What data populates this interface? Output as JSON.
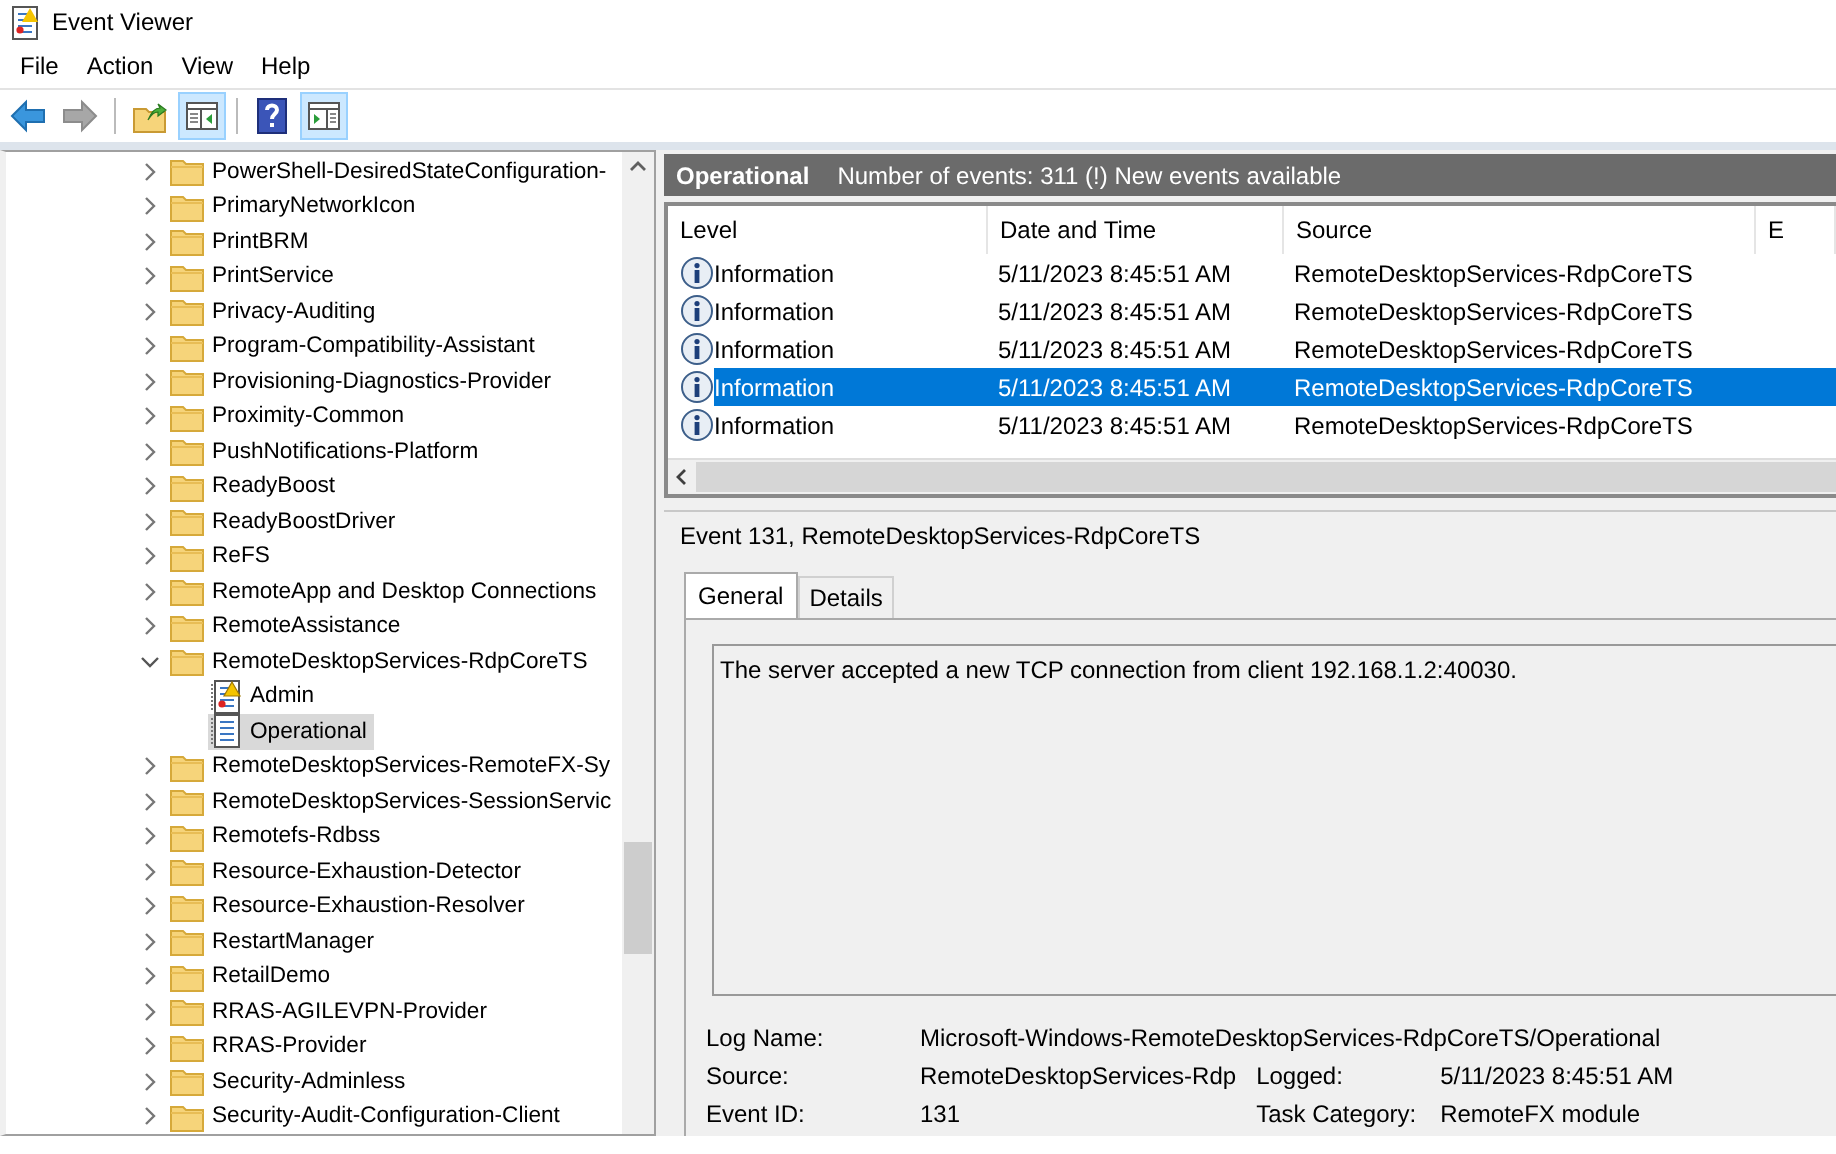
{
  "window": {
    "title": "Event Viewer"
  },
  "menu": [
    "File",
    "Action",
    "View",
    "Help"
  ],
  "toolbar": [
    {
      "kind": "back",
      "on": false,
      "disabled": false
    },
    {
      "kind": "forward",
      "on": false,
      "disabled": true
    },
    {
      "kind": "up",
      "on": false,
      "disabled": false
    },
    {
      "kind": "console-tree",
      "on": true,
      "disabled": false
    },
    {
      "kind": "help",
      "on": false,
      "disabled": false
    },
    {
      "kind": "action-pane",
      "on": true,
      "disabled": false
    }
  ],
  "tree": {
    "items": [
      {
        "label": "PowerShell-DesiredStateConfiguration-",
        "kind": "folder",
        "expanded": false,
        "selected": false
      },
      {
        "label": "PrimaryNetworkIcon",
        "kind": "folder",
        "expanded": false,
        "selected": false
      },
      {
        "label": "PrintBRM",
        "kind": "folder",
        "expanded": false,
        "selected": false
      },
      {
        "label": "PrintService",
        "kind": "folder",
        "expanded": false,
        "selected": false
      },
      {
        "label": "Privacy-Auditing",
        "kind": "folder",
        "expanded": false,
        "selected": false
      },
      {
        "label": "Program-Compatibility-Assistant",
        "kind": "folder",
        "expanded": false,
        "selected": false
      },
      {
        "label": "Provisioning-Diagnostics-Provider",
        "kind": "folder",
        "expanded": false,
        "selected": false
      },
      {
        "label": "Proximity-Common",
        "kind": "folder",
        "expanded": false,
        "selected": false
      },
      {
        "label": "PushNotifications-Platform",
        "kind": "folder",
        "expanded": false,
        "selected": false
      },
      {
        "label": "ReadyBoost",
        "kind": "folder",
        "expanded": false,
        "selected": false
      },
      {
        "label": "ReadyBoostDriver",
        "kind": "folder",
        "expanded": false,
        "selected": false
      },
      {
        "label": "ReFS",
        "kind": "folder",
        "expanded": false,
        "selected": false
      },
      {
        "label": "RemoteApp and Desktop Connections",
        "kind": "folder",
        "expanded": false,
        "selected": false
      },
      {
        "label": "RemoteAssistance",
        "kind": "folder",
        "expanded": false,
        "selected": false
      },
      {
        "label": "RemoteDesktopServices-RdpCoreTS",
        "kind": "folder",
        "expanded": true,
        "selected": false,
        "children": [
          {
            "label": "Admin",
            "kind": "alert-log",
            "selected": false
          },
          {
            "label": "Operational",
            "kind": "log",
            "selected": true
          }
        ]
      },
      {
        "label": "RemoteDesktopServices-RemoteFX-Sy",
        "kind": "folder",
        "expanded": false,
        "selected": false
      },
      {
        "label": "RemoteDesktopServices-SessionServic",
        "kind": "folder",
        "expanded": false,
        "selected": false
      },
      {
        "label": "Remotefs-Rdbss",
        "kind": "folder",
        "expanded": false,
        "selected": false
      },
      {
        "label": "Resource-Exhaustion-Detector",
        "kind": "folder",
        "expanded": false,
        "selected": false
      },
      {
        "label": "Resource-Exhaustion-Resolver",
        "kind": "folder",
        "expanded": false,
        "selected": false
      },
      {
        "label": "RestartManager",
        "kind": "folder",
        "expanded": false,
        "selected": false
      },
      {
        "label": "RetailDemo",
        "kind": "folder",
        "expanded": false,
        "selected": false
      },
      {
        "label": "RRAS-AGILEVPN-Provider",
        "kind": "folder",
        "expanded": false,
        "selected": false
      },
      {
        "label": "RRAS-Provider",
        "kind": "folder",
        "expanded": false,
        "selected": false
      },
      {
        "label": "Security-Adminless",
        "kind": "folder",
        "expanded": false,
        "selected": false
      },
      {
        "label": "Security-Audit-Configuration-Client",
        "kind": "folder",
        "expanded": false,
        "selected": false
      }
    ]
  },
  "log_header": {
    "title": "Operational",
    "summary": "Number of events: 311 (!) New events available"
  },
  "events": {
    "columns": [
      "Level",
      "Date and Time",
      "Source",
      "E"
    ],
    "rows": [
      {
        "level": "Information",
        "date": "5/11/2023 8:45:51 AM",
        "source": "RemoteDesktopServices-RdpCoreTS",
        "selected": false
      },
      {
        "level": "Information",
        "date": "5/11/2023 8:45:51 AM",
        "source": "RemoteDesktopServices-RdpCoreTS",
        "selected": false
      },
      {
        "level": "Information",
        "date": "5/11/2023 8:45:51 AM",
        "source": "RemoteDesktopServices-RdpCoreTS",
        "selected": false
      },
      {
        "level": "Information",
        "date": "5/11/2023 8:45:51 AM",
        "source": "RemoteDesktopServices-RdpCoreTS",
        "selected": true
      },
      {
        "level": "Information",
        "date": "5/11/2023 8:45:51 AM",
        "source": "RemoteDesktopServices-RdpCoreTS",
        "selected": false
      }
    ]
  },
  "detail": {
    "title": "Event 131, RemoteDesktopServices-RdpCoreTS",
    "tabs": [
      {
        "label": "General",
        "selected": true
      },
      {
        "label": "Details",
        "selected": false
      }
    ],
    "message": "The server accepted a new TCP connection from client 192.168.1.2:40030.",
    "field_rows": [
      [
        {
          "label": "Log Name:",
          "value": "Microsoft-Windows-RemoteDesktopServices-RdpCoreTS/Operational"
        }
      ],
      [
        {
          "label": "Source:",
          "value": "RemoteDesktopServices-Rdp"
        },
        {
          "label": "Logged:",
          "value": "5/11/2023 8:45:51 AM"
        }
      ],
      [
        {
          "label": "Event ID:",
          "value": "131"
        },
        {
          "label": "Task Category:",
          "value": "RemoteFX module"
        }
      ]
    ]
  }
}
